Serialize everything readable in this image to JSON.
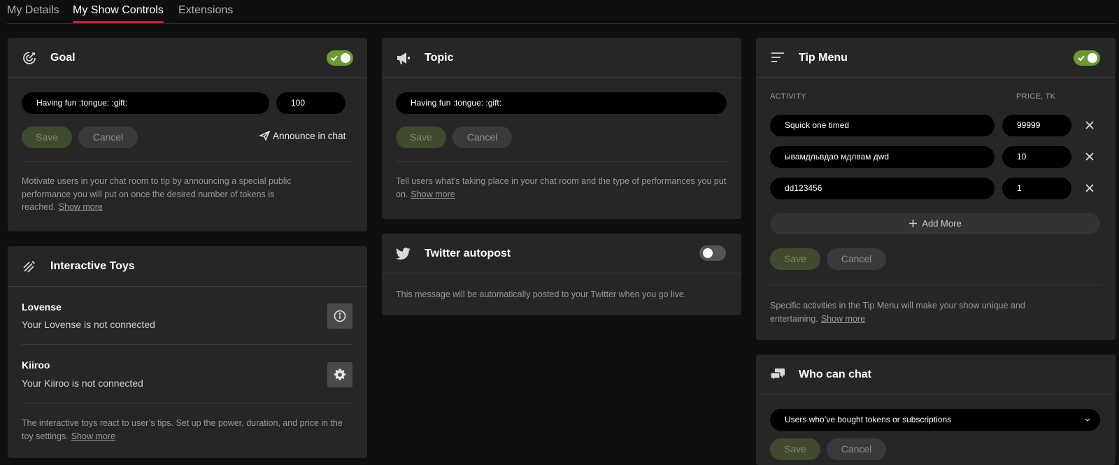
{
  "tabs": [
    {
      "label": "My Details"
    },
    {
      "label": "My Show Controls"
    },
    {
      "label": "Extensions"
    }
  ],
  "goal": {
    "title": "Goal",
    "icon": "target-icon",
    "enabled": true,
    "text_value": "Having fun :tongue: :gift:",
    "amount_value": "100",
    "save_label": "Save",
    "cancel_label": "Cancel",
    "announce_label": "Announce in chat",
    "description": "Motivate users in your chat room to tip by announcing a special public performance you will put on once the desired number of tokens is reached.",
    "show_more": "Show more"
  },
  "toys": {
    "title": "Interactive Toys",
    "icon": "toys-icon",
    "items": [
      {
        "name": "Lovense",
        "status": "Your Lovense is not connected",
        "action_icon": "info-icon"
      },
      {
        "name": "Kiiroo",
        "status": "Your Kiiroo is not connected",
        "action_icon": "gear-icon"
      }
    ],
    "description": "The interactive toys react to user’s tips. Set up the power, duration, and price in the toy settings.",
    "show_more": "Show more"
  },
  "topic": {
    "title": "Topic",
    "icon": "megaphone-icon",
    "text_value": "Having fun :tongue: :gift:",
    "save_label": "Save",
    "cancel_label": "Cancel",
    "description": "Tell users what’s taking place in your chat room and the type of performances you put on.",
    "show_more": "Show more"
  },
  "twitter": {
    "title": "Twitter autopost",
    "icon": "twitter-icon",
    "enabled": false,
    "description": "This message will be automatically posted to your Twitter when you go live."
  },
  "tip_menu": {
    "title": "Tip Menu",
    "icon": "list-icon",
    "enabled": true,
    "col_activity": "ACTIVITY",
    "col_price": "PRICE, TK",
    "items": [
      {
        "activity": "Squick one timed",
        "price": "99999"
      },
      {
        "activity": "ывамдльвдао мдлвам дwd",
        "price": "10"
      },
      {
        "activity": "dd123456",
        "price": "1"
      }
    ],
    "add_more_label": "Add More",
    "save_label": "Save",
    "cancel_label": "Cancel",
    "description": "Specific activities in the Tip Menu will make your show unique and entertaining.",
    "show_more": "Show more"
  },
  "who_can_chat": {
    "title": "Who can chat",
    "icon": "chat-bubbles-icon",
    "selected": "Users who’ve bought tokens or subscriptions",
    "save_label": "Save",
    "cancel_label": "Cancel"
  },
  "colors": {
    "accent": "#c7212d",
    "toggle_on": "#6b9a2e",
    "panel": "#262626",
    "background": "#0f0f0f"
  }
}
